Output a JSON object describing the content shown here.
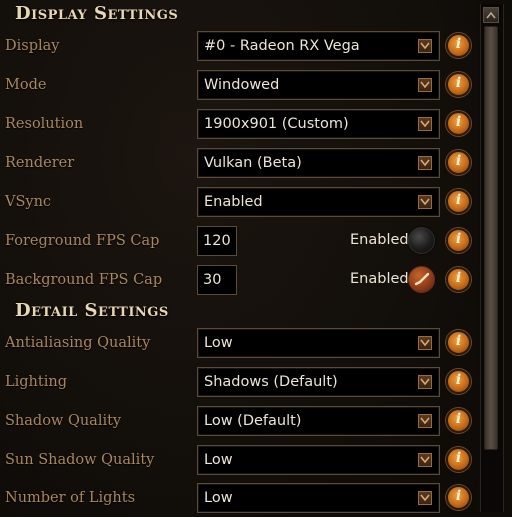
{
  "display_section": {
    "title": "Display Settings",
    "rows": [
      {
        "label": "Display",
        "value": "#0 - Radeon RX Vega"
      },
      {
        "label": "Mode",
        "value": "Windowed"
      },
      {
        "label": "Resolution",
        "value": "1900x901 (Custom)"
      },
      {
        "label": "Renderer",
        "value": "Vulkan (Beta)"
      },
      {
        "label": "VSync",
        "value": "Enabled"
      }
    ],
    "fps_rows": [
      {
        "label": "Foreground FPS Cap",
        "value": "120",
        "toggle_label": "Enabled",
        "toggle_on": false
      },
      {
        "label": "Background FPS Cap",
        "value": "30",
        "toggle_label": "Enabled",
        "toggle_on": true
      }
    ]
  },
  "detail_section": {
    "title": "Detail Settings",
    "rows": [
      {
        "label": "Antialiasing Quality",
        "value": "Low"
      },
      {
        "label": "Lighting",
        "value": "Shadows (Default)"
      },
      {
        "label": "Shadow Quality",
        "value": "Low (Default)"
      },
      {
        "label": "Sun Shadow Quality",
        "value": "Low"
      },
      {
        "label": "Number of Lights",
        "value": "Low"
      }
    ]
  },
  "info_icon_glyph": "i",
  "icons": {
    "dropdown": "chevron-down-icon",
    "info": "info-icon",
    "checkbox_on": "checkmark-icon",
    "scroll_up": "arrow-up-icon"
  },
  "colors": {
    "label": "#a88660",
    "title": "#e8d7b4",
    "value": "#ece4d6",
    "accent": "#c46a18"
  }
}
